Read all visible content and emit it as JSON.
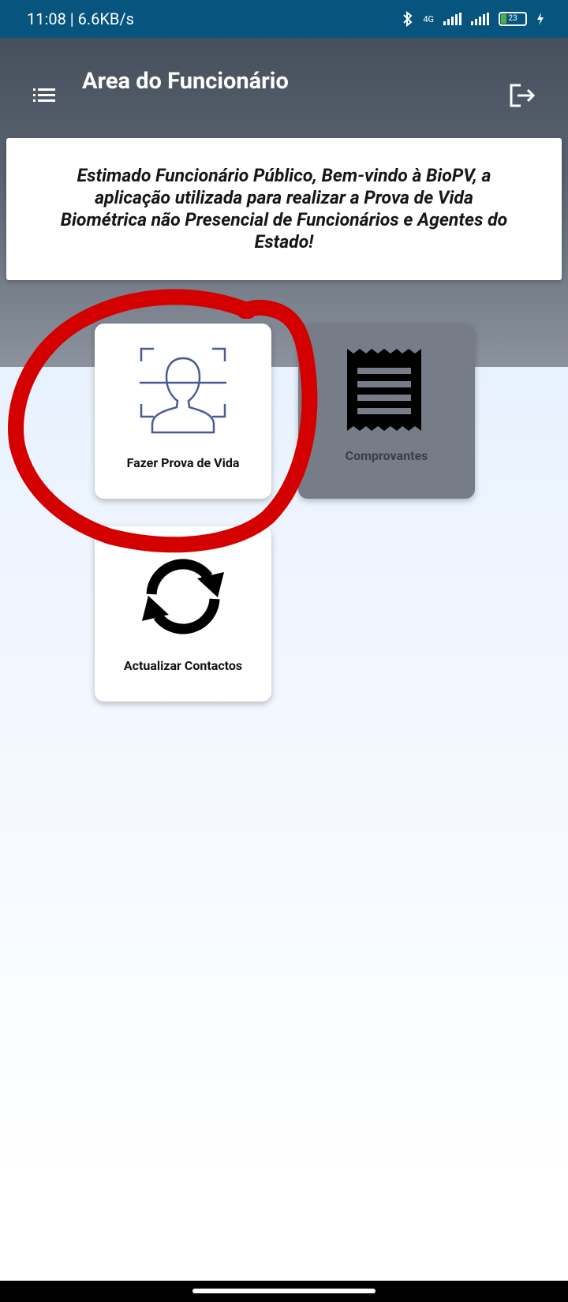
{
  "status_bar": {
    "time": "11:08 | 6.6KB/s",
    "network": "4G",
    "battery": "23"
  },
  "header": {
    "title": "Area do Funcionário"
  },
  "welcome": {
    "text": "Estimado Funcionário Público, Bem-vindo à BioPV, a aplicação utilizada para realizar a Prova de Vida Biométrica não Presencial de Funcionários e Agentes do Estado!"
  },
  "tiles": [
    {
      "label": "Fazer Prova de Vida",
      "icon": "face-scan-icon"
    },
    {
      "label": "Comprovantes",
      "icon": "receipt-icon"
    },
    {
      "label": "Actualizar Contactos",
      "icon": "refresh-icon"
    }
  ],
  "colors": {
    "status_bar": "#07547f",
    "header_top": "#46505d",
    "annotation": "#d40000",
    "face_icon": "#4b5a94"
  }
}
